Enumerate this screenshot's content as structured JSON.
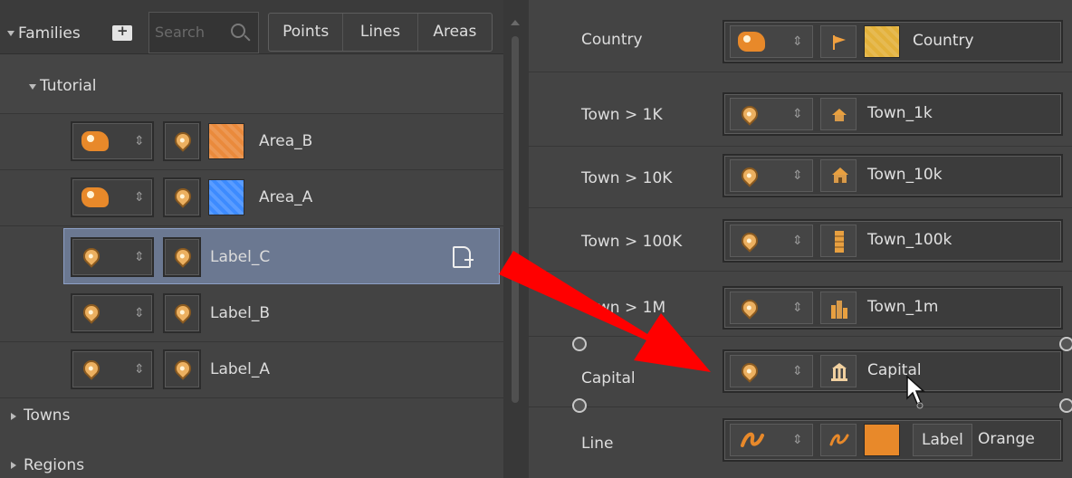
{
  "toolbar": {
    "families_label": "Families",
    "search_placeholder": "Search",
    "filters": [
      "Points",
      "Lines",
      "Areas"
    ]
  },
  "tree": {
    "group_label": "Tutorial",
    "items": [
      {
        "name": "Area_B",
        "type_icon": "area-shape-icon",
        "swatch": "orange-texture"
      },
      {
        "name": "Area_A",
        "type_icon": "area-shape-icon",
        "swatch": "blue-texture"
      },
      {
        "name": "Label_C",
        "type_icon": "point-pin-icon",
        "selected": true
      },
      {
        "name": "Label_B",
        "type_icon": "point-pin-icon"
      },
      {
        "name": "Label_A",
        "type_icon": "point-pin-icon"
      }
    ],
    "collapsed_groups": [
      "Towns",
      "Regions"
    ]
  },
  "styles": [
    {
      "label": "Country",
      "value": "Country",
      "icon": "flag-icon",
      "swatch": "yellow-texture"
    },
    {
      "label": "Town > 1K",
      "value": "Town_1k",
      "icon": "house-icon"
    },
    {
      "label": "Town > 10K",
      "value": "Town_10k",
      "icon": "house-big-icon"
    },
    {
      "label": "Town > 100K",
      "value": "Town_100k",
      "icon": "tower-icon"
    },
    {
      "label": "Town > 1M",
      "value": "Town_1m",
      "icon": "skyline-icon"
    },
    {
      "label": "Capital",
      "value": "Capital",
      "icon": "capitol-icon"
    },
    {
      "label": "Line",
      "value_label": "Label",
      "value": "Orange",
      "icon": "line-curve-icon",
      "swatch": "orange-flat"
    }
  ],
  "colors": {
    "selection_bg": "#6b7891",
    "accent_orange": "#e8892a",
    "arrow_red": "#ff0000",
    "area_blue": "#3d8bff",
    "country_yellow": "#e3b13a"
  }
}
